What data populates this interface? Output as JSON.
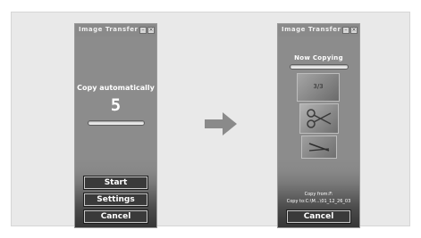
{
  "left_window": {
    "title": "Image Transfer",
    "minimize_glyph": "–",
    "close_glyph": "×",
    "copy_label": "Copy automatically",
    "countdown": "5",
    "buttons": {
      "start": "Start",
      "settings": "Settings",
      "cancel": "Cancel"
    }
  },
  "right_window": {
    "title": "Image Transfer",
    "minimize_glyph": "–",
    "close_glyph": "×",
    "status": "Now Copying",
    "progress_count": "3/3",
    "copy_from": "Copy from:F:",
    "copy_to": "Copy to:C:\\M...\\01_12_26_03",
    "buttons": {
      "cancel": "Cancel"
    }
  },
  "icons": {
    "arrow": "right-arrow-icon",
    "scissors": "scissors-icon"
  },
  "colors": {
    "stage": "#e9e9e9",
    "window": "#8c8c8c",
    "arrow": "#8a8a8a"
  }
}
